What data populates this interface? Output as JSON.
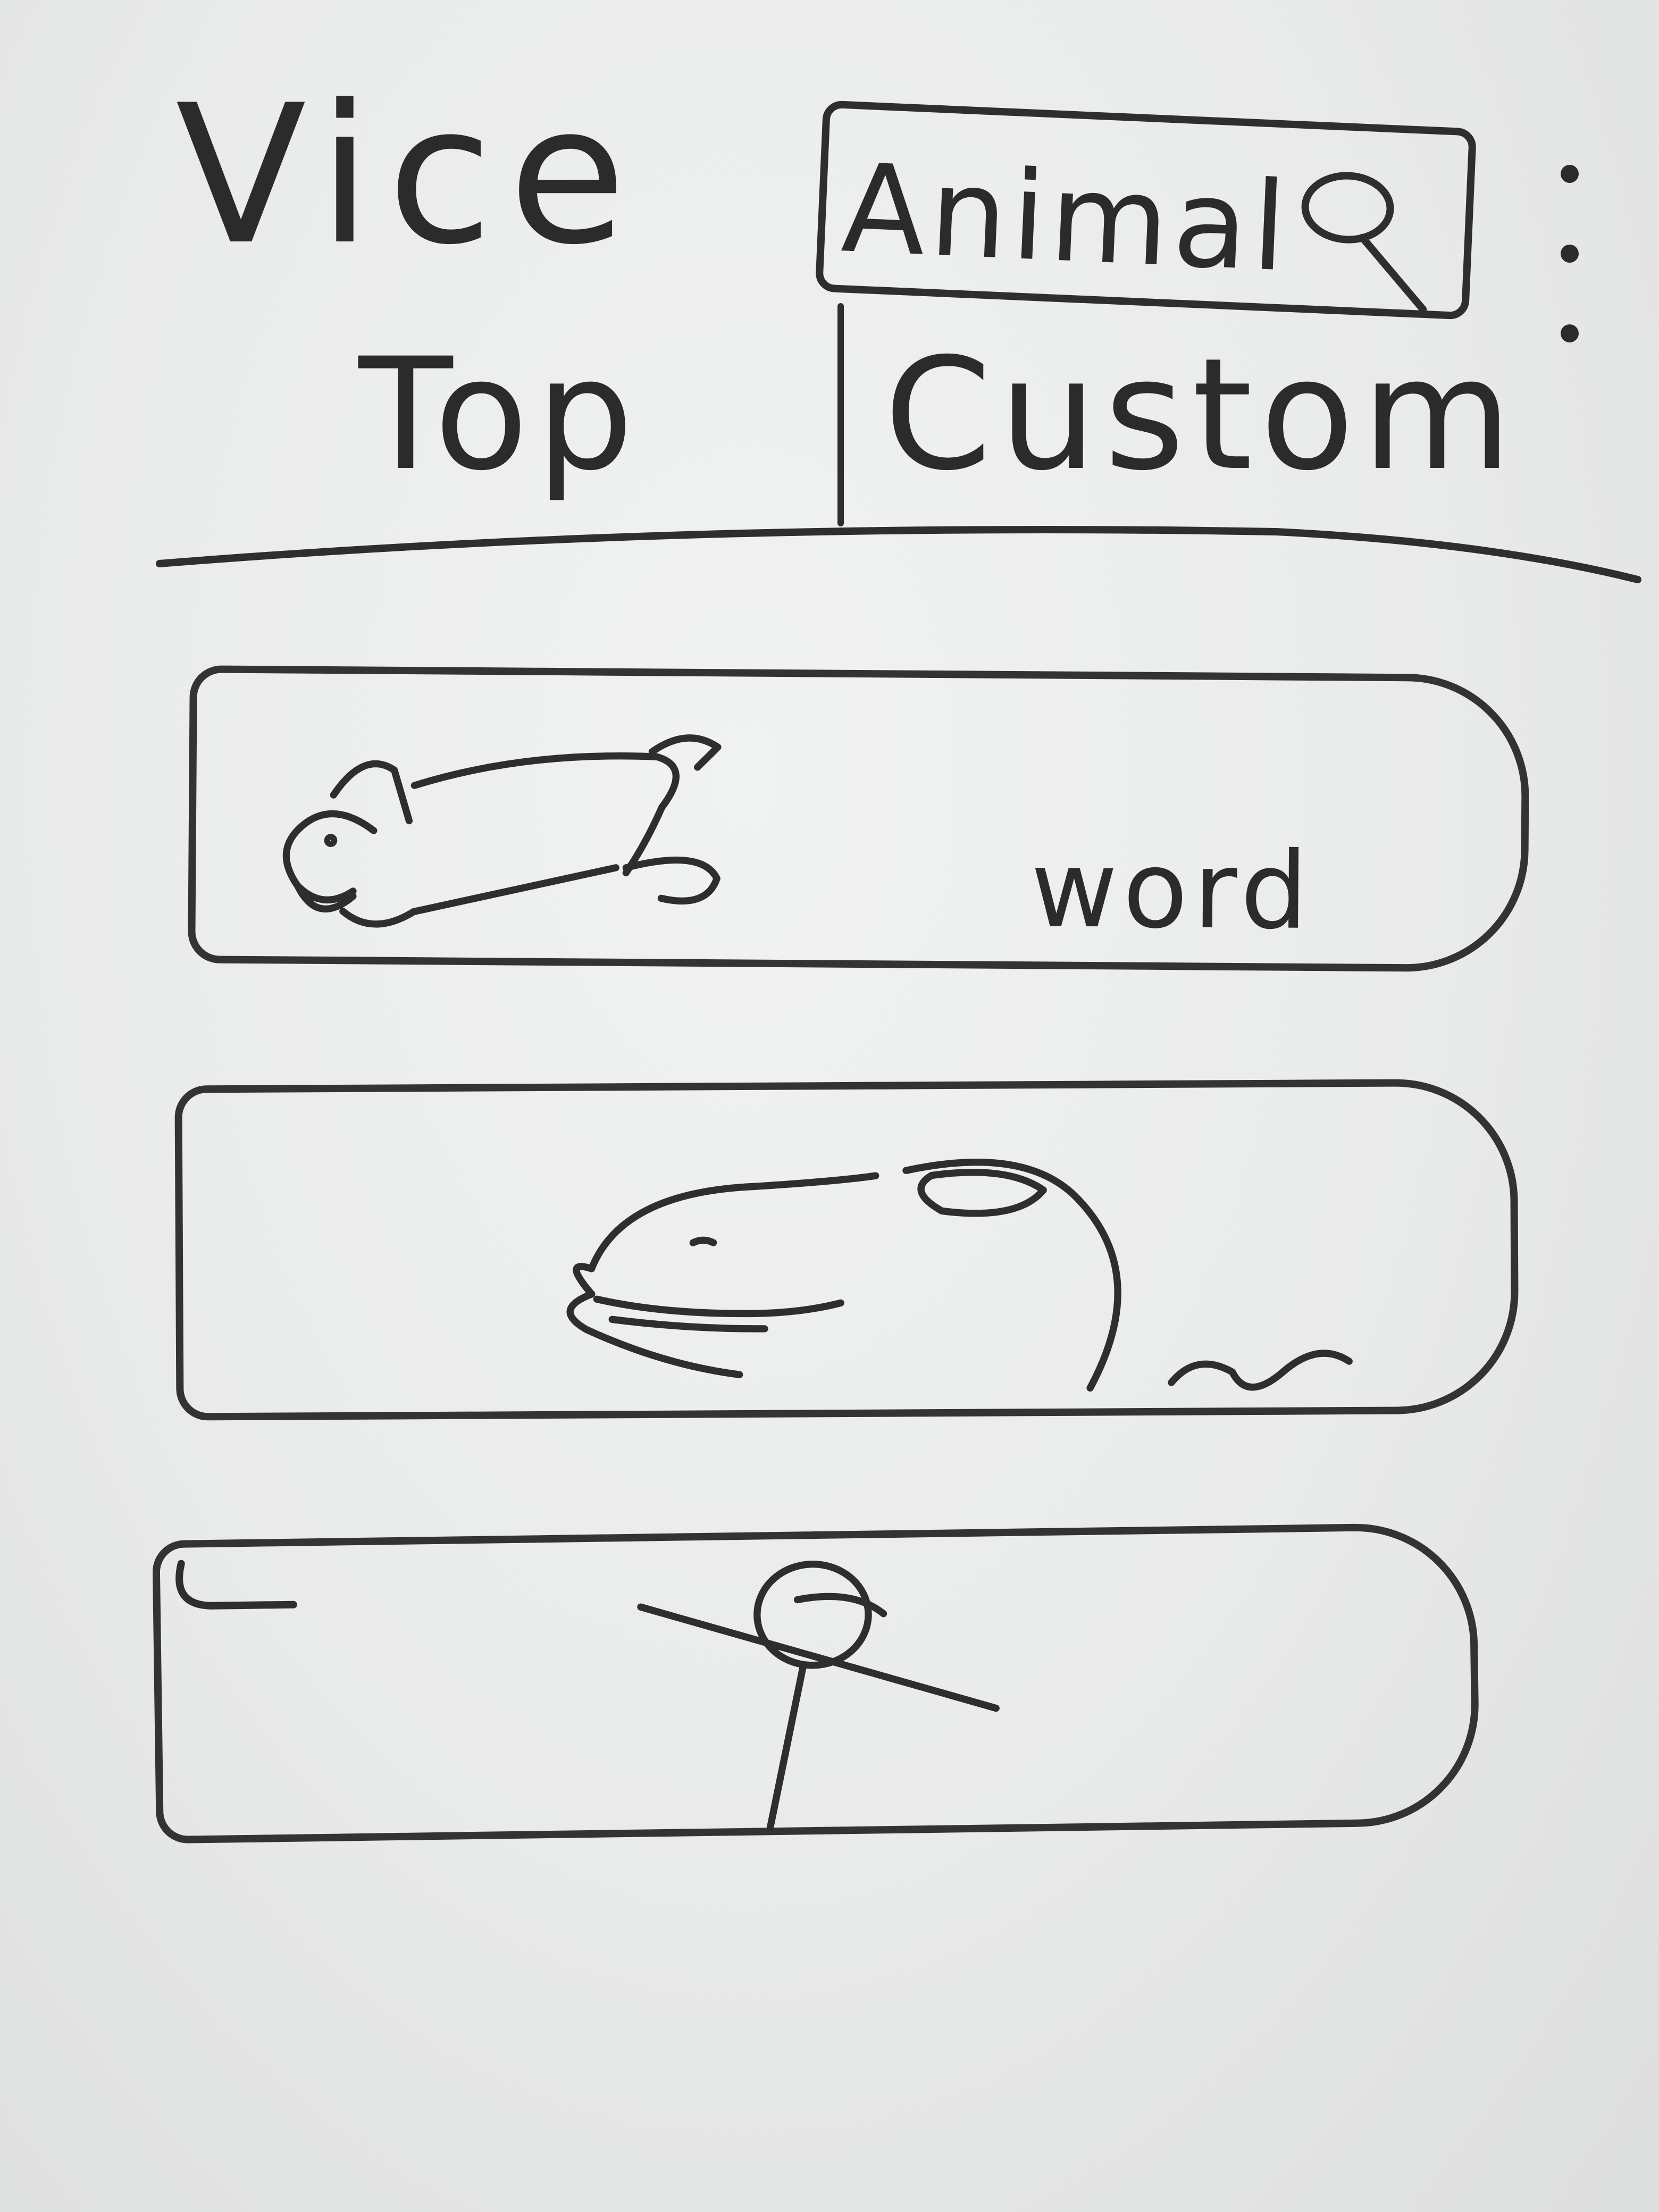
{
  "header": {
    "title": "Vice",
    "search": {
      "value": "Animal",
      "icon": "search-icon"
    },
    "menu_icon": "more-vertical-icon"
  },
  "tabs": [
    {
      "label": "Top"
    },
    {
      "label": "Custom"
    }
  ],
  "cards": [
    {
      "image": "fox-sketch",
      "caption": "word"
    },
    {
      "image": "animal-head-sketch"
    },
    {
      "image": "stick-figure-sketch"
    }
  ],
  "colors": {
    "ink": "#2e2e2e",
    "paper": "#ebecec"
  }
}
